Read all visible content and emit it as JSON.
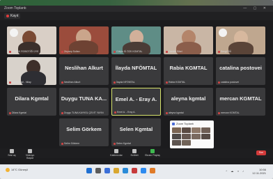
{
  "window": {
    "title": "Zoom Toplantı"
  },
  "recording": {
    "label": "Kayıt"
  },
  "participants": [
    {
      "name": "",
      "label": "HUKUK ROBOTİĞİ ÜYE"
    },
    {
      "name": "",
      "label": "Zeynep Sultan"
    },
    {
      "name": "",
      "label": "Gülçin Sİ ÖZK KGMTAL"
    },
    {
      "name": "",
      "label": "Cemile Sibel"
    },
    {
      "name": "",
      "label": "Sevgi Sİİİ"
    },
    {
      "name": "",
      "label": "Özlem Ağıl - Nilay"
    },
    {
      "name": "Neslihan Alkurt",
      "label": "Neslihan Alkurt"
    },
    {
      "name": "İlayda NFÖMTAL",
      "label": "İlayda NFÖMTAL"
    },
    {
      "name": "Rabia KGMTAL",
      "label": "Rabia KGMTAL"
    },
    {
      "name": "catalina postovei",
      "label": "catalina postovei"
    },
    {
      "name": "Dilara Kgmtal",
      "label": "Dilara Kgmtal"
    },
    {
      "name": "Duygu TUNA KA...",
      "label": "Duygu TUNA KAYKSL ÇEVİT YAYIN"
    },
    {
      "name": "Emel A. - Eray A.",
      "label": "Emel A. - Eray A."
    },
    {
      "name": "aleyna kgmtal",
      "label": "aleyna kgmtal"
    },
    {
      "name": "mercan KGMTAL",
      "label": "mercan KGMTAL"
    },
    {
      "name": "Selim Görkem",
      "label": "Selim Görkem"
    },
    {
      "name": "Selen Kgmtal",
      "label": "Selen Kgmtal"
    }
  ],
  "shared_window": {
    "title": "Zoom Toplantı"
  },
  "controls": {
    "mute": "Sesi aç",
    "video": "Videoyu Başlat",
    "participants": "Katılımcılar",
    "chat": "Sohbet",
    "share": "Ekranı Paylaş",
    "end": "Son"
  },
  "taskbar": {
    "weather": "14°C Güneşli",
    "time": "10:56",
    "date": "12.11.2021"
  }
}
